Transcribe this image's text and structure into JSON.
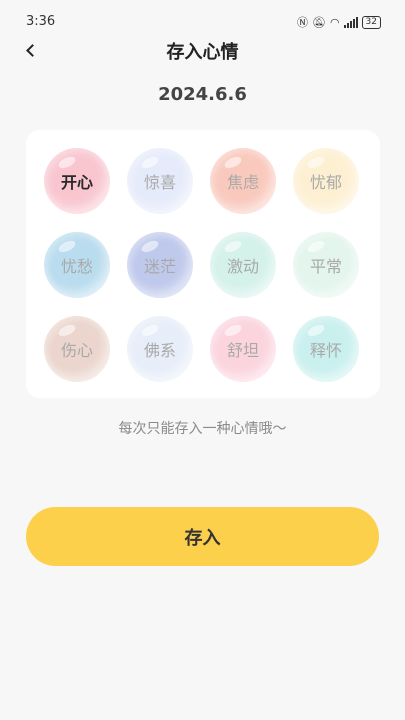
{
  "status_bar": {
    "time": "3:36",
    "battery": "32"
  },
  "header": {
    "title": "存入心情"
  },
  "date": "2024.6.6",
  "moods": [
    {
      "label": "开心",
      "color": "#f9c6d0",
      "selected": true
    },
    {
      "label": "惊喜",
      "color": "#e6ebfb",
      "selected": false
    },
    {
      "label": "焦虑",
      "color": "#f9c9bd",
      "selected": false
    },
    {
      "label": "忧郁",
      "color": "#fdf0d2",
      "selected": false
    },
    {
      "label": "忧愁",
      "color": "#b9dcee",
      "selected": false
    },
    {
      "label": "迷茫",
      "color": "#bfc9ec",
      "selected": false
    },
    {
      "label": "激动",
      "color": "#d4f1ea",
      "selected": false
    },
    {
      "label": "平常",
      "color": "#e3f5ec",
      "selected": false
    },
    {
      "label": "伤心",
      "color": "#ebd5cd",
      "selected": false
    },
    {
      "label": "佛系",
      "color": "#e7eef9",
      "selected": false
    },
    {
      "label": "舒坦",
      "color": "#fbd4de",
      "selected": false
    },
    {
      "label": "释怀",
      "color": "#c9f0ef",
      "selected": false
    }
  ],
  "hint": "每次只能存入一种心情哦～",
  "save_button": {
    "label": "存入"
  },
  "colors": {
    "accent": "#fcd04b",
    "background": "#f7f7f7"
  }
}
